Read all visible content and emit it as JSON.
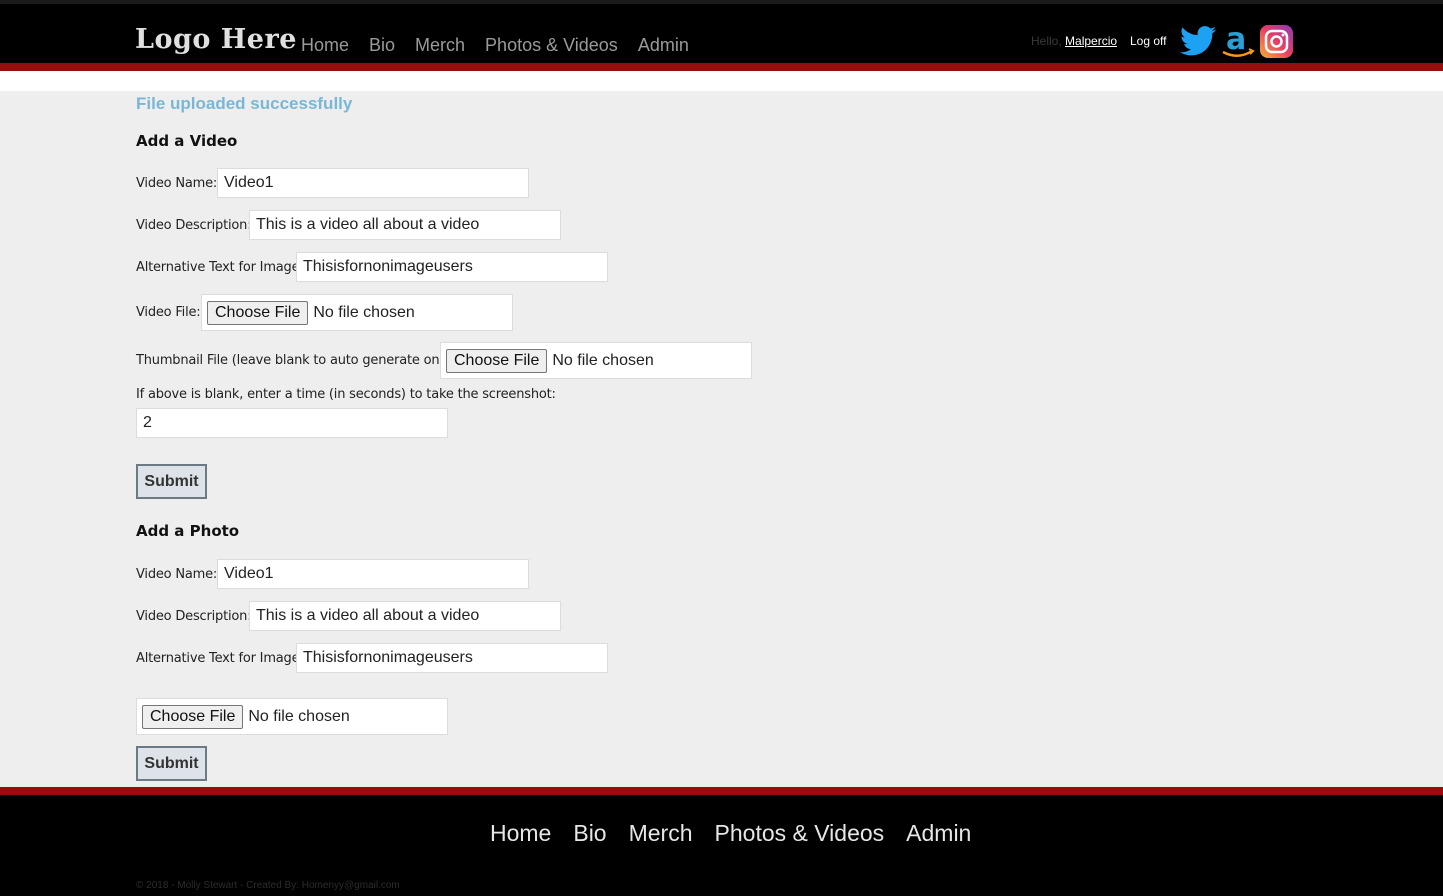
{
  "header": {
    "logo": "Logo Here",
    "nav": [
      "Home",
      "Bio",
      "Merch",
      "Photos & Videos",
      "Admin"
    ],
    "greeting": "Hello,",
    "username": "Malpercio",
    "logoff": "Log off",
    "social_icons": [
      "twitter-icon",
      "amazon-icon",
      "instagram-icon"
    ]
  },
  "status": {
    "message": "File uploaded successfully"
  },
  "video_form": {
    "heading": "Add a Video",
    "name_label": "Video Name:",
    "name_value": "Video1",
    "description_label": "Video Description:",
    "description_value": "This is a video all about a video",
    "alt_label": "Alternative Text for Image:",
    "alt_value": "Thisisfornonimageusers",
    "video_file_label": "Video File:",
    "thumbnail_label": "Thumbnail File (leave blank to auto generate one):",
    "time_label": "If above is blank, enter a time (in seconds) to take the screenshot:",
    "time_value": "2",
    "choose_file": "Choose File",
    "no_file": "No file chosen",
    "submit": "Submit"
  },
  "photo_form": {
    "heading": "Add a Photo",
    "name_label": "Video Name:",
    "name_value": "Video1",
    "description_label": "Video Description:",
    "description_value": "This is a video all about a video",
    "alt_label": "Alternative Text for Image:",
    "alt_value": "Thisisfornonimageusers",
    "choose_file": "Choose File",
    "no_file": "No file chosen",
    "submit": "Submit"
  },
  "footer": {
    "nav": [
      "Home",
      "Bio",
      "Merch",
      "Photos & Videos",
      "Admin"
    ],
    "copyright": "© 2018 - Molly Stewart - Created By: Homenyy@gmail.com"
  },
  "colors": {
    "accent_red": "#9b0d0d",
    "success_blue": "#7ab7d6",
    "background": "#eeeeee"
  }
}
